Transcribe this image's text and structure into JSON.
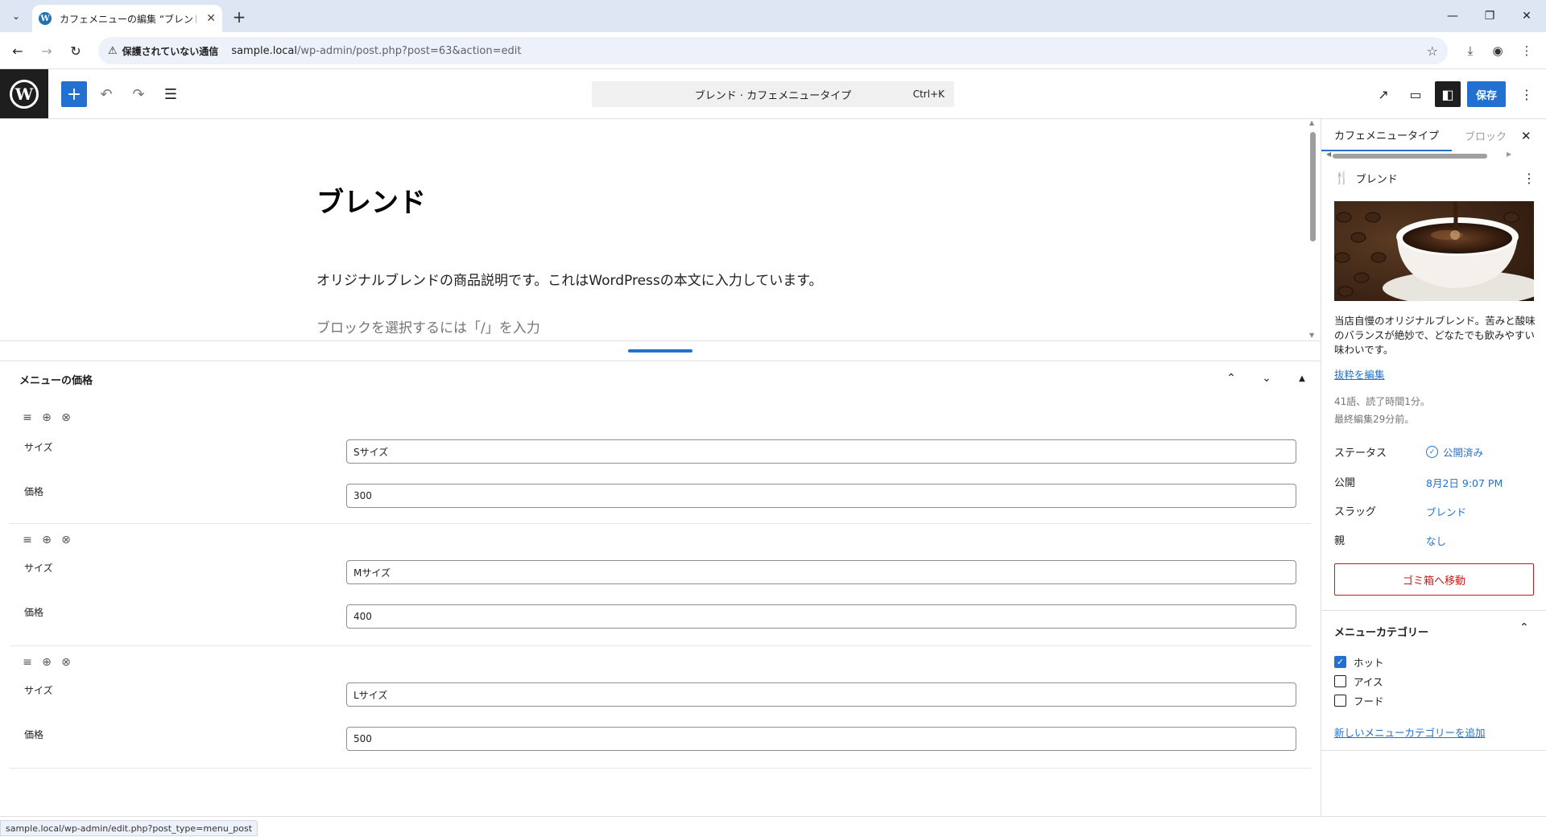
{
  "browser": {
    "tab_title": "カフェメニューの編集 “ブレンド” ‹ サン",
    "insecure_label": "保護されていない通信",
    "url_host": "sample.local",
    "url_path": "/wp-admin/post.php?post=63&action=edit"
  },
  "editor": {
    "command_center": "ブレンド · カフェメニュータイプ",
    "command_shortcut": "Ctrl+K",
    "save_label": "保存"
  },
  "post": {
    "title": "ブレンド",
    "body": "オリジナルブレンドの商品説明です。これはWordPressの本文に入力しています。",
    "placeholder": "ブロックを選択するには「/」を入力"
  },
  "metabox": {
    "title": "メニューの価格",
    "rows": [
      {
        "size_label": "サイズ",
        "size_value": "Sサイズ",
        "price_label": "価格",
        "price_value": "300"
      },
      {
        "size_label": "サイズ",
        "size_value": "Mサイズ",
        "price_label": "価格",
        "price_value": "400"
      },
      {
        "size_label": "サイズ",
        "size_value": "Lサイズ",
        "price_label": "価格",
        "price_value": "500"
      }
    ]
  },
  "sidebar": {
    "tabs": [
      "カフェメニュータイプ",
      "ブロック"
    ],
    "post_name": "ブレンド",
    "excerpt": "当店自慢のオリジナルブレンド。苦みと酸味のバランスが絶妙で、どなたでも飲みやすい味わいです。",
    "edit_excerpt": "抜粋を編集",
    "word_stats": "41語、読了時間1分。",
    "last_edited": "最終編集29分前。",
    "status_label": "ステータス",
    "status_value": "公開済み",
    "publish_label": "公開",
    "publish_value": "8月2日 9:07 PM",
    "slug_label": "スラッグ",
    "slug_value": "ブレンド",
    "parent_label": "親",
    "parent_value": "なし",
    "trash_label": "ゴミ箱へ移動",
    "category_panel_title": "メニューカテゴリー",
    "categories": [
      {
        "label": "ホット",
        "checked": true
      },
      {
        "label": "アイス",
        "checked": false
      },
      {
        "label": "フード",
        "checked": false
      }
    ],
    "add_category": "新しいメニューカテゴリーを追加"
  },
  "status_url": "sample.local/wp-admin/edit.php?post_type=menu_post",
  "colors": {
    "accent": "#2271d1",
    "danger": "#cc1818",
    "toolbar_dark": "#1e1e1e"
  },
  "icons": [
    "chevron-down-icon",
    "wordpress-icon",
    "close-icon",
    "plus-icon",
    "back-icon",
    "forward-icon",
    "reload-icon",
    "warning-icon",
    "star-icon",
    "download-icon",
    "profile-icon",
    "kebab-icon",
    "undo-icon",
    "redo-icon",
    "document-overview-icon",
    "external-link-icon",
    "preview-device-icon",
    "sidebar-toggle-icon",
    "drag-handle-icon",
    "add-circle-icon",
    "remove-circle-icon",
    "chevron-up-icon",
    "menu-type-icon",
    "check-circle-icon"
  ]
}
